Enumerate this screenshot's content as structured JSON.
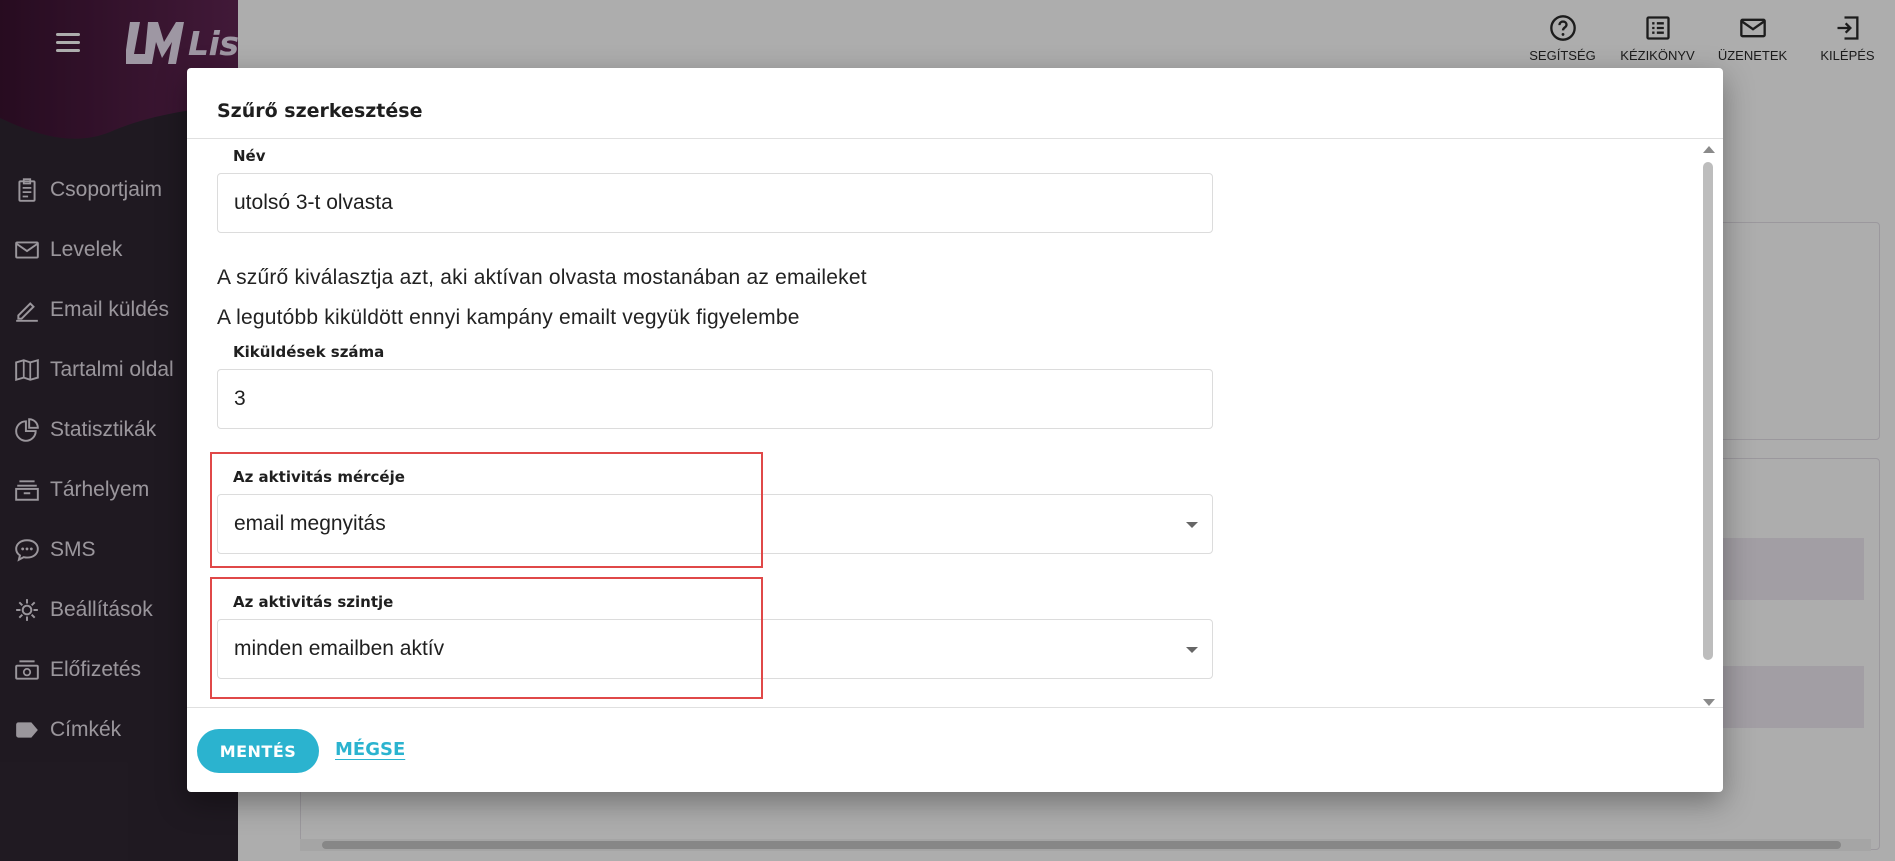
{
  "app": {
    "brand": "ListaMester",
    "accent_color": "#2bb3cf",
    "sidebar_bg": "#2f2632",
    "highlight_color": "#e04848"
  },
  "sidebar": {
    "items": [
      {
        "label": "Csoportjaim",
        "icon": "clipboard-icon"
      },
      {
        "label": "Levelek",
        "icon": "mail-icon"
      },
      {
        "label": "Email küldés",
        "icon": "pen-icon"
      },
      {
        "label": "Tartalmi oldal",
        "icon": "book-icon"
      },
      {
        "label": "Statisztikák",
        "icon": "pie-chart-icon"
      },
      {
        "label": "Tárhelyem",
        "icon": "archive-icon"
      },
      {
        "label": "SMS",
        "icon": "chat-icon"
      },
      {
        "label": "Beállítások",
        "icon": "gear-icon"
      },
      {
        "label": "Előfizetés",
        "icon": "cash-icon"
      },
      {
        "label": "Címkék",
        "icon": "tag-icon"
      }
    ]
  },
  "topbar": {
    "actions": [
      {
        "label": "SEGÍTSÉG",
        "icon": "help-icon"
      },
      {
        "label": "KÉZIKÖNYV",
        "icon": "manual-icon"
      },
      {
        "label": "ÜZENETEK",
        "icon": "messages-icon"
      },
      {
        "label": "KILÉPÉS",
        "icon": "logout-icon"
      }
    ]
  },
  "dialog": {
    "title": "Szűrő szerkesztése",
    "name_label": "Név",
    "name_value": "utolsó 3-t olvasta",
    "description": "A szűrő kiválasztja azt, aki aktívan olvasta mostanában az emaileket",
    "campaign_hint": "A legutóbb kiküldött ennyi kampány emailt vegyük figyelembe",
    "sends_label": "Kiküldések száma",
    "sends_value": "3",
    "measure_label": "Az aktivitás mércéje",
    "measure_value": "email megnyitás",
    "level_label": "Az aktivitás szintje",
    "level_value": "minden emailben aktív",
    "save_label": "MENTÉS",
    "cancel_label": "MÉGSE"
  }
}
